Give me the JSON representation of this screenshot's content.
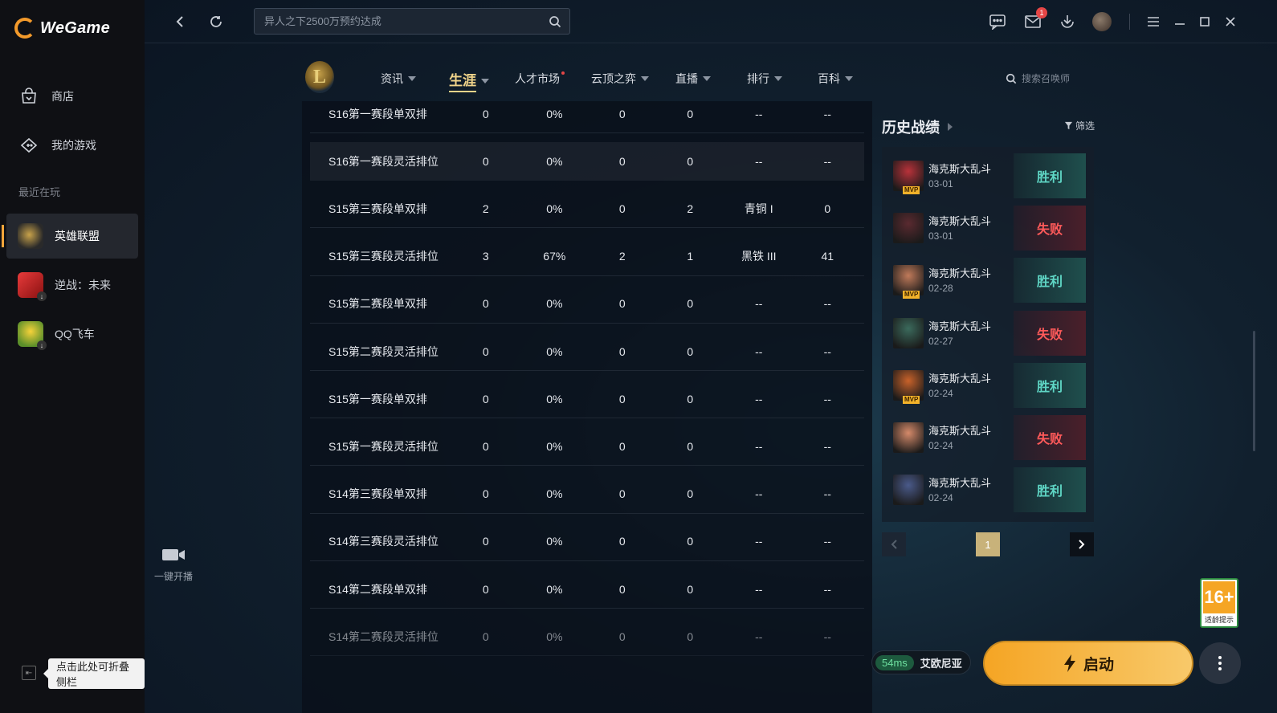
{
  "app": {
    "name": "WeGame"
  },
  "sidebar": {
    "items": [
      {
        "label": "商店",
        "icon": "shop-icon"
      },
      {
        "label": "我的游戏",
        "icon": "gamepad-icon"
      }
    ],
    "recent_label": "最近在玩",
    "games": [
      {
        "label": "英雄联盟",
        "active": true
      },
      {
        "label": "逆战：未来",
        "active": false
      },
      {
        "label": "QQ飞车",
        "active": false
      }
    ],
    "collapse_tip": "点击此处可折叠侧栏"
  },
  "topbar": {
    "search_placeholder": "异人之下2500万预约达成",
    "mail_badge": "1"
  },
  "game_nav": {
    "items": [
      {
        "label": "资讯",
        "caret": true
      },
      {
        "label": "生涯",
        "caret": true,
        "active": true
      },
      {
        "label": "人才市场",
        "caret": false,
        "dot": true
      },
      {
        "label": "云顶之弈",
        "caret": true
      },
      {
        "label": "直播",
        "caret": true
      },
      {
        "label": "排行",
        "caret": true
      },
      {
        "label": "百科",
        "caret": true
      }
    ],
    "summoner_search_placeholder": "搜索召唤师"
  },
  "live": {
    "label": "一键开播"
  },
  "season_table": {
    "rows": [
      [
        "S16第一赛段单双排",
        "0",
        "0%",
        "0",
        "0",
        "--",
        "--"
      ],
      [
        "S16第一赛段灵活排位",
        "0",
        "0%",
        "0",
        "0",
        "--",
        "--"
      ],
      [
        "S15第三赛段单双排",
        "2",
        "0%",
        "0",
        "2",
        "青铜 I",
        "0"
      ],
      [
        "S15第三赛段灵活排位",
        "3",
        "67%",
        "2",
        "1",
        "黑铁 III",
        "41"
      ],
      [
        "S15第二赛段单双排",
        "0",
        "0%",
        "0",
        "0",
        "--",
        "--"
      ],
      [
        "S15第二赛段灵活排位",
        "0",
        "0%",
        "0",
        "0",
        "--",
        "--"
      ],
      [
        "S15第一赛段单双排",
        "0",
        "0%",
        "0",
        "0",
        "--",
        "--"
      ],
      [
        "S15第一赛段灵活排位",
        "0",
        "0%",
        "0",
        "0",
        "--",
        "--"
      ],
      [
        "S14第三赛段单双排",
        "0",
        "0%",
        "0",
        "0",
        "--",
        "--"
      ],
      [
        "S14第三赛段灵活排位",
        "0",
        "0%",
        "0",
        "0",
        "--",
        "--"
      ],
      [
        "S14第二赛段单双排",
        "0",
        "0%",
        "0",
        "0",
        "--",
        "--"
      ],
      [
        "S14第二赛段灵活排位",
        "0",
        "0%",
        "0",
        "0",
        "--",
        "--"
      ]
    ]
  },
  "history": {
    "title": "历史战绩",
    "filter_label": "筛选",
    "mvp_label": "MVP",
    "matches": [
      {
        "mode": "海克斯大乱斗",
        "date": "03-01",
        "result": "胜利",
        "win": true,
        "mvp": true,
        "color": "#b8323a"
      },
      {
        "mode": "海克斯大乱斗",
        "date": "03-01",
        "result": "失败",
        "win": false,
        "mvp": false,
        "color": "#5a2a30"
      },
      {
        "mode": "海克斯大乱斗",
        "date": "02-28",
        "result": "胜利",
        "win": true,
        "mvp": true,
        "color": "#c07a5a"
      },
      {
        "mode": "海克斯大乱斗",
        "date": "02-27",
        "result": "失败",
        "win": false,
        "mvp": false,
        "color": "#3b6a5c"
      },
      {
        "mode": "海克斯大乱斗",
        "date": "02-24",
        "result": "胜利",
        "win": true,
        "mvp": true,
        "color": "#c8622a"
      },
      {
        "mode": "海克斯大乱斗",
        "date": "02-24",
        "result": "失败",
        "win": false,
        "mvp": false,
        "color": "#d58a6a"
      },
      {
        "mode": "海克斯大乱斗",
        "date": "02-24",
        "result": "胜利",
        "win": true,
        "mvp": false,
        "color": "#4a5a8a"
      }
    ],
    "page": "1"
  },
  "launcher": {
    "ping": "54ms",
    "server": "艾欧尼亚",
    "start_label": "启动",
    "age_rating": "16+",
    "age_org": "CADPA",
    "age_tip": "适龄提示"
  }
}
